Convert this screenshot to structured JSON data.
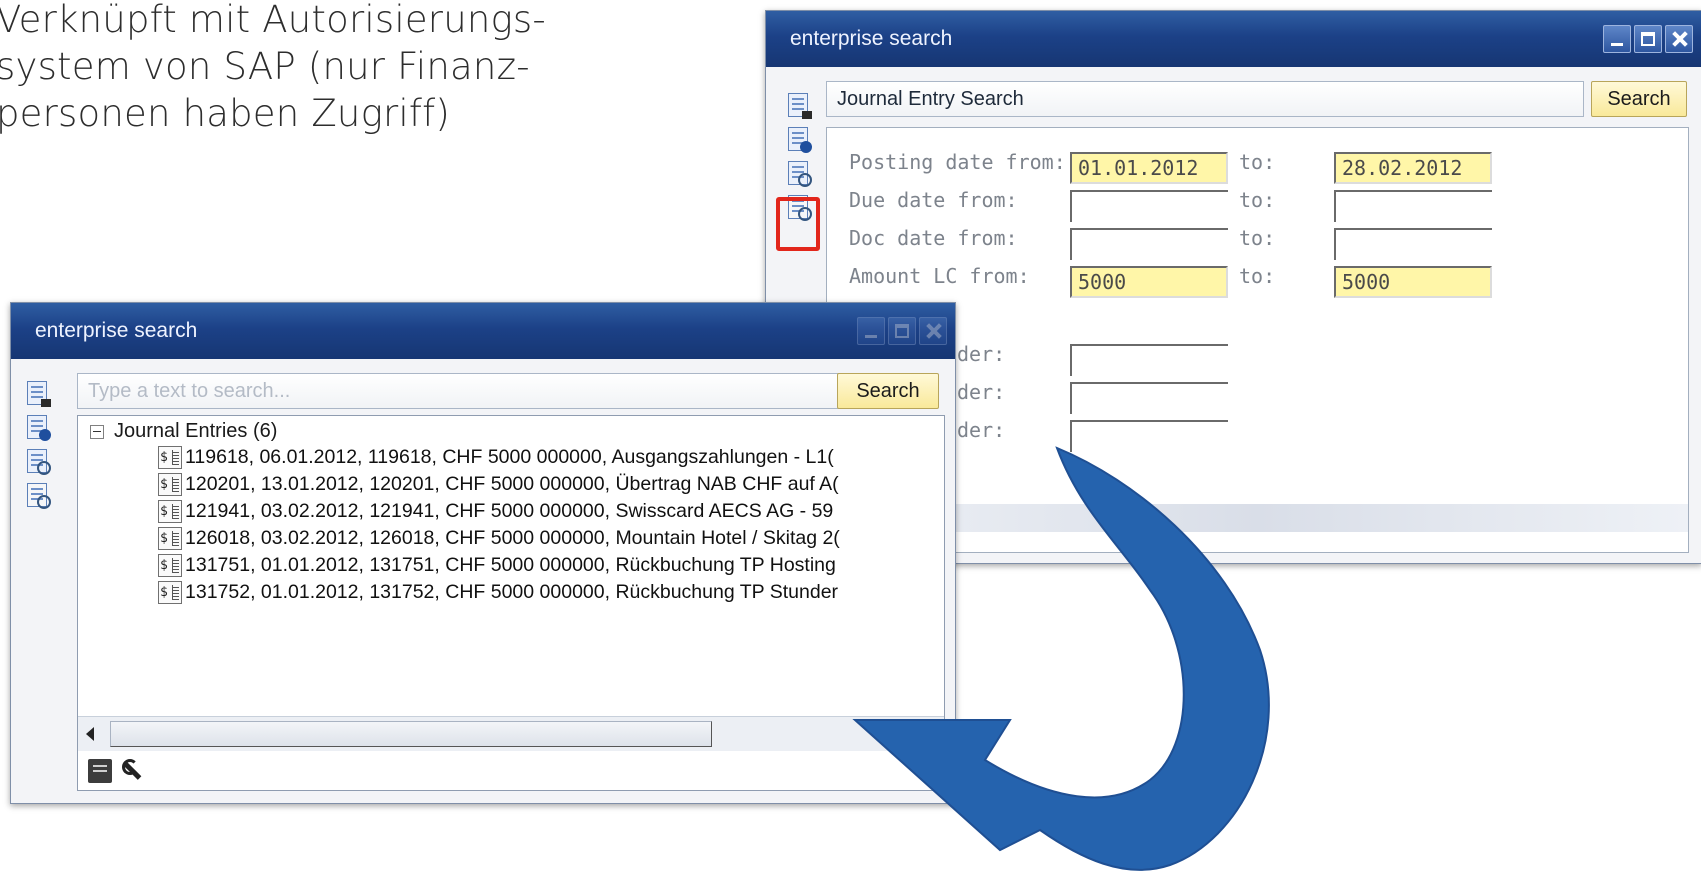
{
  "caption": {
    "lines": [
      "Verknüpft mit Autorisierungs-",
      "system von SAP (nur Finanz-",
      "personen haben Zugriff)"
    ]
  },
  "journal_window": {
    "title": "enterprise search",
    "search_box_value": "Journal Entry Search",
    "search_button": "Search",
    "fields": [
      {
        "label": "Posting date from:",
        "from": "01.01.2012",
        "to_label": "to:",
        "to": "28.02.2012"
      },
      {
        "label": "Due date from:",
        "from": "",
        "to_label": "to:",
        "to": ""
      },
      {
        "label": "Doc date from:",
        "from": "",
        "to_label": "to:",
        "to": ""
      },
      {
        "label": "Amount LC from:",
        "from": "5000",
        "to_label": "to:",
        "to": "5000"
      }
    ],
    "partial_labels": [
      "der:",
      "der:",
      "der:"
    ]
  },
  "results_window": {
    "title": "enterprise search",
    "search_placeholder": "Type a text to search...",
    "search_button": "Search",
    "tree_root": "Journal Entries (6)",
    "entry_icon_text": "$",
    "entries": [
      "119618, 06.01.2012, 119618, CHF 5000 000000, Ausgangszahlungen - L1(",
      "120201, 13.01.2012, 120201, CHF 5000 000000, Übertrag NAB CHF auf A(",
      "121941, 03.02.2012, 121941, CHF 5000 000000, Swisscard AECS AG - 59",
      "126018, 03.02.2012, 126018, CHF 5000 000000, Mountain Hotel / Skitag 2(",
      "131751, 01.01.2012, 131751, CHF 5000 000000, Rückbuchung TP Hosting",
      "131752, 01.01.2012, 131752, CHF 5000 000000, Rückbuchung TP Stunder"
    ]
  },
  "colors": {
    "titlebar": "#1c4187",
    "highlight_box": "#e2261b",
    "search_button_bg": "#f9e99a",
    "filled_field": "#fff6a8",
    "arrow": "#2563ae"
  },
  "icons": {
    "sidebar": [
      "journal-icon",
      "user-card-icon",
      "document-search-icon",
      "money-search-icon"
    ],
    "results_toolbar": [
      "database-icon",
      "wrench-icon"
    ]
  }
}
